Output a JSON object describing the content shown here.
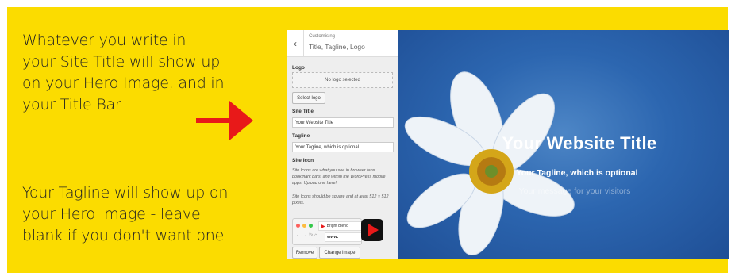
{
  "explanations": {
    "site_title_note": [
      "Whatever you write in",
      "your Site Title will show up",
      "on your Hero Image, and in",
      "your Title Bar"
    ],
    "tagline_note": [
      "Your Tagline will show up on",
      "your Hero Image - leave",
      "blank if you don't want one"
    ]
  },
  "customizer": {
    "header_small": "Customising",
    "header_title": "Title, Tagline, Logo",
    "back_icon": "chevron-left-icon",
    "logo_label": "Logo",
    "logo_placeholder": "No logo selected",
    "select_logo_button": "Select logo",
    "site_title_label": "Site Title",
    "site_title_value": "Your Website Title",
    "tagline_label": "Tagline",
    "tagline_value": "Your Tagline, which is optional",
    "site_icon_label": "Site Icon",
    "site_icon_desc_1": "Site Icons are what you see in browser tabs, bookmark bars, and within the WordPress mobile apps. Upload one here!",
    "site_icon_desc_2": "Site Icons should be square and at least 512 × 512 pixels.",
    "preview_tab_label": "Bright Blend",
    "preview_url": "www.",
    "remove_button": "Remove",
    "change_image_button": "Change image"
  },
  "hero": {
    "title": "Your Website Title",
    "tagline": "Your Tagline, which is optional",
    "message": "Your message for your visitors"
  },
  "colors": {
    "background": "#fbdc00",
    "arrow": "#e81919",
    "hero_blue": "#2c66b0"
  }
}
